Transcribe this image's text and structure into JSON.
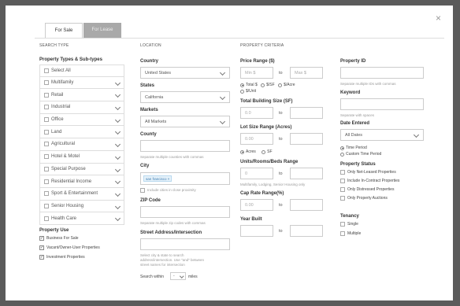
{
  "close_label": "×",
  "tabs": [
    "For Sale",
    "For Lease"
  ],
  "sections": {
    "search_type": "SEARCH TYPE",
    "location": "LOCATION",
    "criteria": "PROPERTY CRITERIA"
  },
  "search_type": {
    "pt_label": "Property Types & Sub-types",
    "types": [
      "Select All",
      "Multifamily",
      "Retail",
      "Industrial",
      "Office",
      "Land",
      "Agricultural",
      "Hotel & Motel",
      "Special Purpose",
      "Residential Income",
      "Sport & Entertainment",
      "Senior Housing",
      "Health Care"
    ],
    "use_label": "Property Use",
    "uses": [
      "Business For Sale",
      "Vacant/Owner-User Properties",
      "Investment Properties"
    ],
    "check_mark": "✓"
  },
  "location": {
    "country_label": "Country",
    "country_value": "United States",
    "states_label": "States",
    "states_value": "California",
    "markets_label": "Markets",
    "markets_value": "All Markets",
    "county_label": "County",
    "county_hint": "Separate multiple counties with commas",
    "city_label": "City",
    "city_chip": "san francisco ×",
    "nearby_label": "Include cities in close proximity",
    "zip_label": "ZIP Code",
    "zip_hint": "Separate multiple zip codes with commas",
    "address_label": "Street Address/Intersection",
    "address_hint_1": "Select city & state to search",
    "address_hint_2": "address/intersection. Use \"and\" between",
    "address_hint_3": "street names for intersection",
    "search_within": "Search within",
    "miles_value": "-",
    "miles_label": "miles"
  },
  "criteria": {
    "price_label": "Price Range ($)",
    "min_ph": "Min $",
    "max_ph": "Max $",
    "to": "to",
    "price_opts": [
      "Total $",
      "$/SF",
      "$/Acre",
      "$/Unit"
    ],
    "bldg_label": "Total Building Size (SF)",
    "bldg_min": "0.0",
    "lot_label": "Lot Size Range (Acres)",
    "lot_min": "0.00",
    "lot_opts": [
      "Acres",
      "SF"
    ],
    "units_label": "Units/Rooms/Beds Range",
    "units_min": "0",
    "units_hint": "Multifamily, Lodging, Senior Housing only",
    "cap_label": "Cap Rate Range(%)",
    "cap_min": "0.00",
    "year_label": "Year Built"
  },
  "right": {
    "pid_label": "Property ID",
    "pid_hint": "Separate multiple IDs with commas",
    "kw_label": "Keyword",
    "kw_hint": "Separate with spaces",
    "date_label": "Date Entered",
    "date_value": "All Dates",
    "date_opts": [
      "Time Period",
      "Custom Time Period"
    ],
    "status_label": "Property Status",
    "statuses": [
      "Only Net-Leased Properties",
      "Include In-Contract Properties",
      "Only Distressed Properties",
      "Only Property Auctions"
    ],
    "tenancy_label": "Tenancy",
    "tenancy": [
      "Single",
      "Multiple"
    ]
  }
}
